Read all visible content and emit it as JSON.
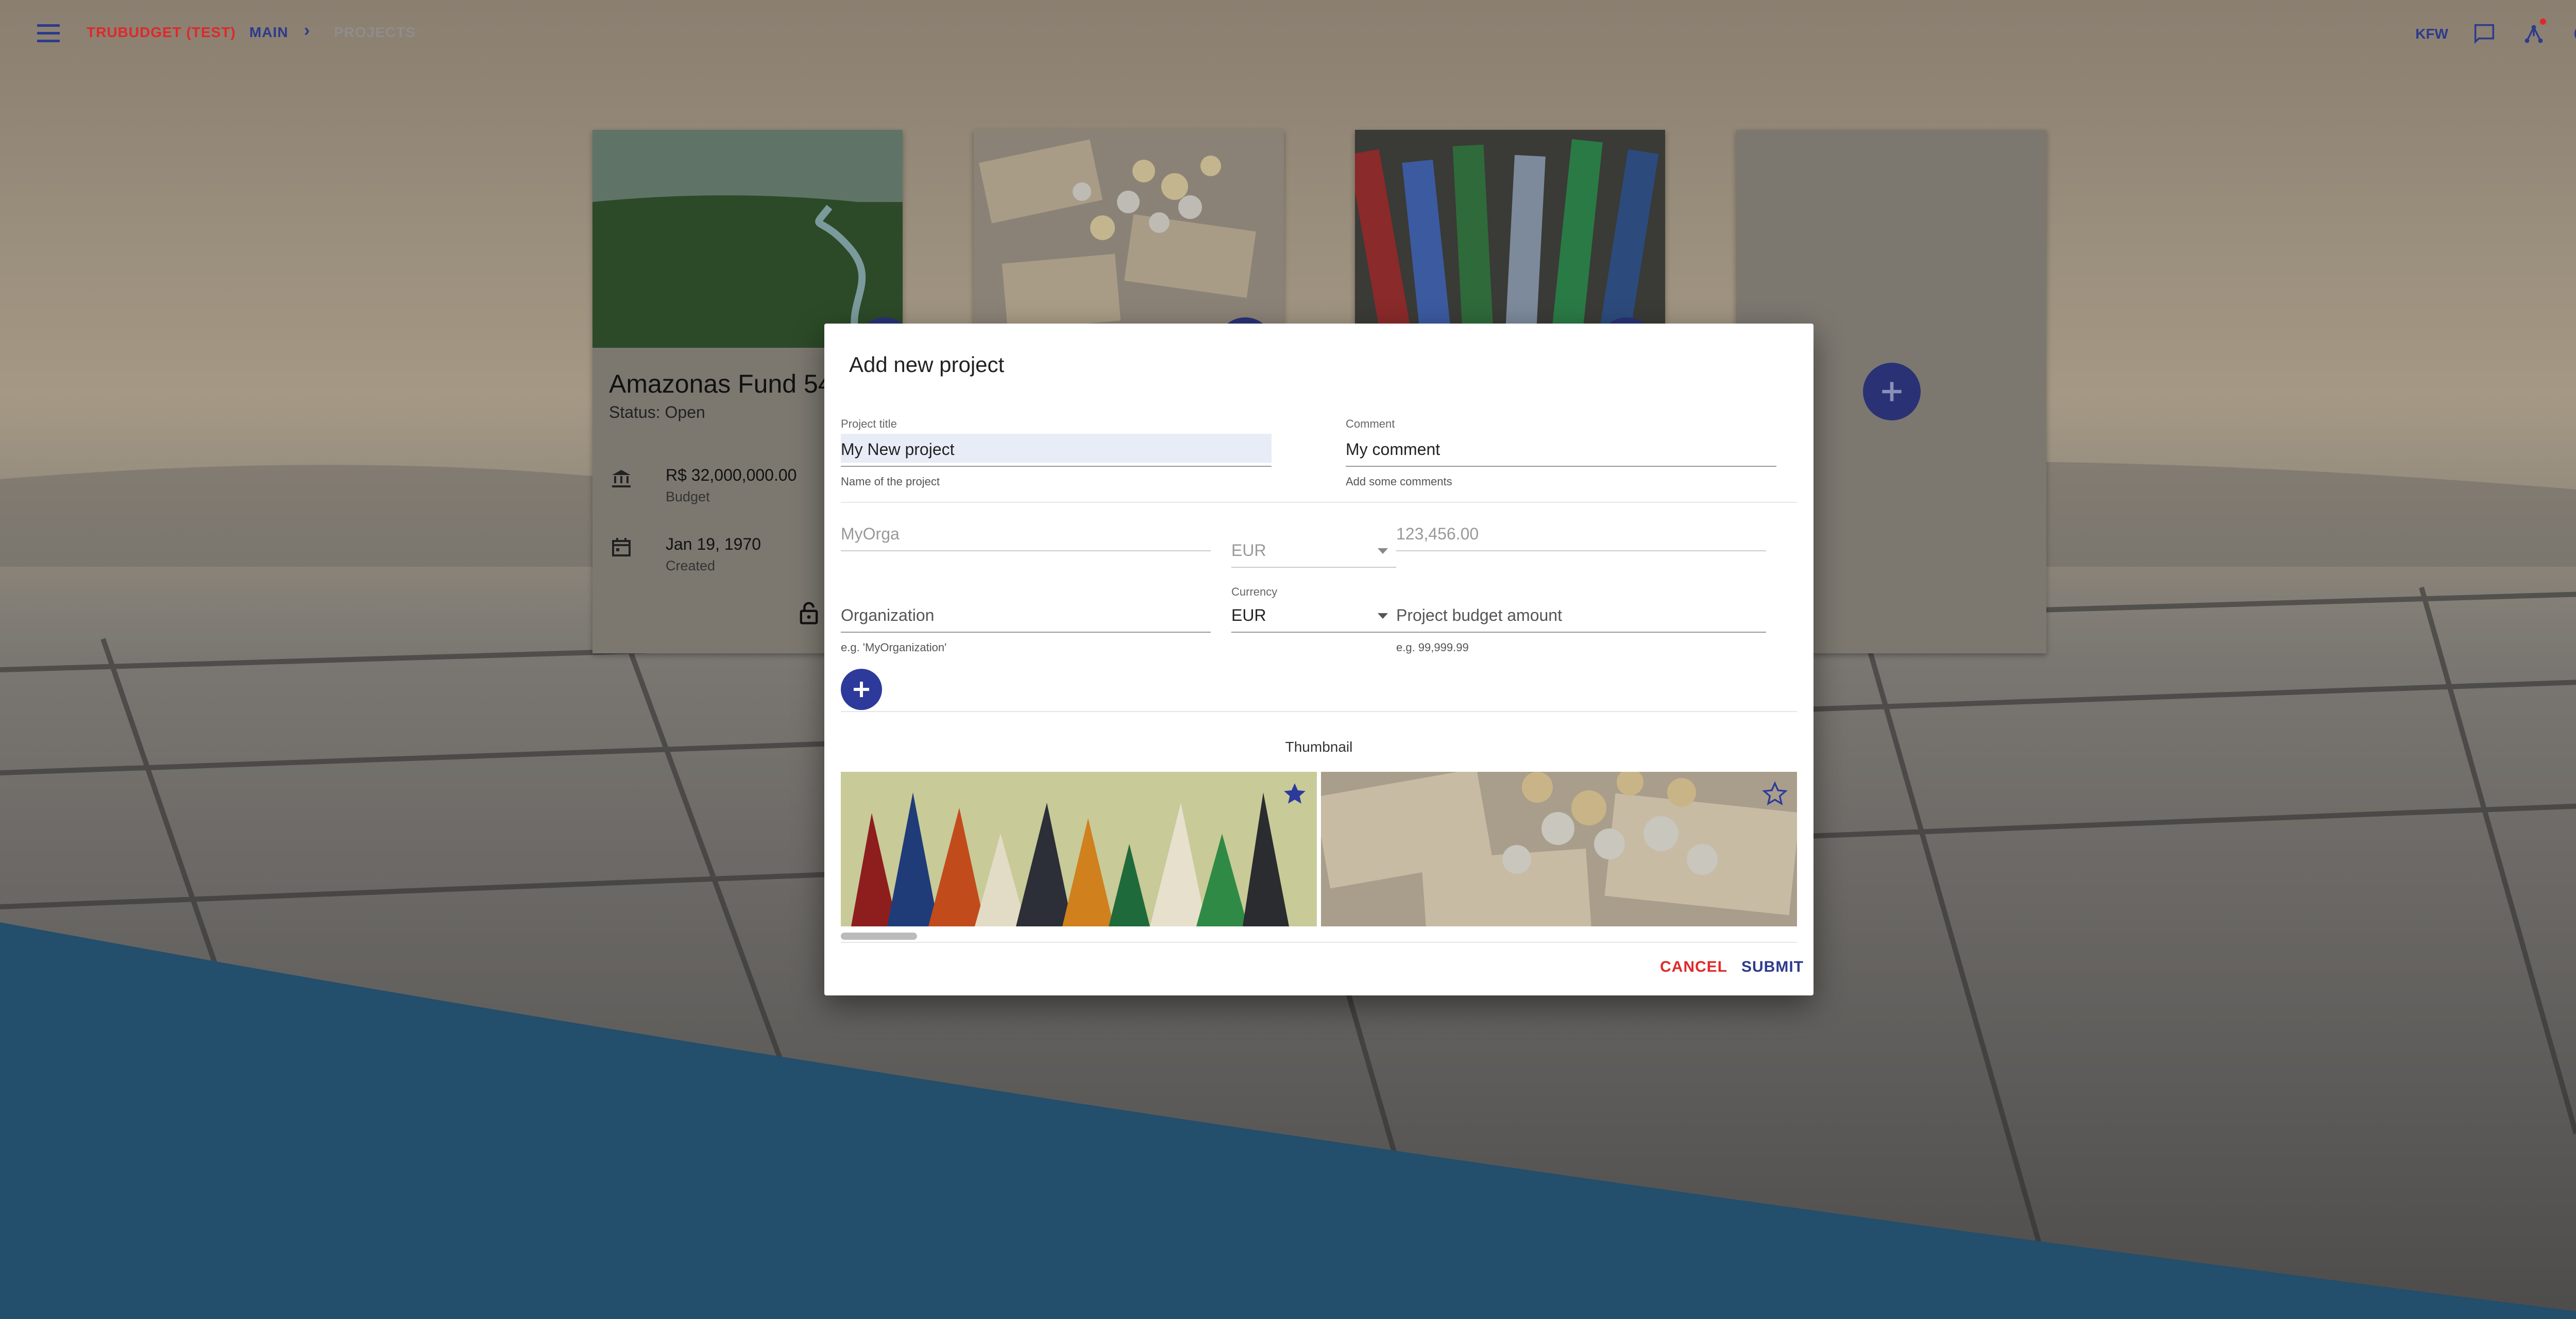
{
  "appbar": {
    "brand": "TRUBUDGET (TEST)",
    "main": "MAIN",
    "separator": "›",
    "current": "PROJECTS",
    "user": "KFW",
    "icons": [
      "menu-icon",
      "chat-icon",
      "network-icon",
      "power-icon"
    ],
    "accent": "#2d3a8c",
    "brand_color": "#e0282a"
  },
  "cards": [
    {
      "title": "Amazonas Fund 54",
      "status": "Status: Open",
      "budget": "R$ 32,000,000.00",
      "budget_label": "Budget",
      "date": "Jan 19, 1970",
      "date_label": "Created"
    }
  ],
  "dialog": {
    "title": "Add new project",
    "project_title": {
      "label": "Project title",
      "value": "My New project",
      "helper": "Name of the project"
    },
    "comment": {
      "label": "Comment",
      "value": "My comment",
      "helper": "Add some comments"
    },
    "existing_row": {
      "organization": "MyOrga",
      "currency": "EUR",
      "amount": "123,456.00"
    },
    "new_row": {
      "organization_placeholder": "Organization",
      "organization_helper": "e.g. 'MyOrganization'",
      "currency_label": "Currency",
      "currency_value": "EUR",
      "amount_placeholder": "Project budget amount",
      "amount_helper": "e.g. 99,999.99"
    },
    "thumbnail_label": "Thumbnail",
    "actions": {
      "cancel": "CANCEL",
      "submit": "SUBMIT"
    }
  }
}
